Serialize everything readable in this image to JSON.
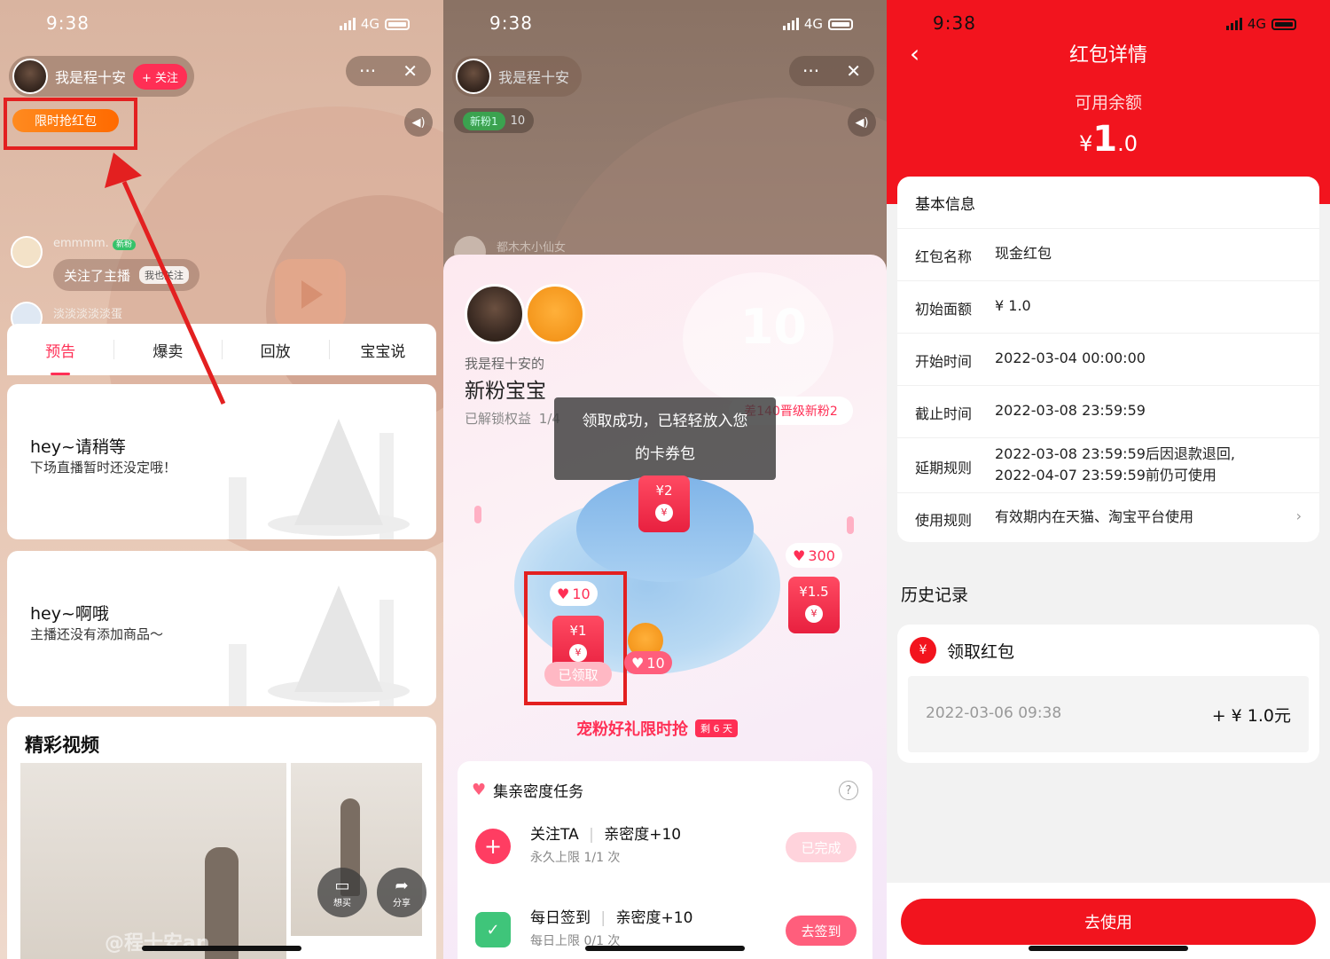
{
  "status": {
    "time": "9:38",
    "network": "4G"
  },
  "panel1": {
    "host_name": "我是程十安",
    "follow_label": "+ 关注",
    "more_label": "···",
    "close_label": "✕",
    "redpacket_tag": "限时抢红包",
    "chat": [
      {
        "user": "emmmm.",
        "badge": "新粉",
        "message": "关注了主播",
        "tag": "我也关注"
      },
      {
        "user": "淡淡淡淡淡蛋"
      }
    ],
    "tabs": [
      "预告",
      "爆卖",
      "回放",
      "宝宝说"
    ],
    "cards": [
      {
        "title": "hey~请稍等",
        "subtitle": "下场直播暂时还没定哦！"
      },
      {
        "title": "hey~啊哦",
        "subtitle": "主播还没有添加商品～"
      }
    ],
    "video_section_title": "精彩视频",
    "watermark": "@程十安an",
    "float_buttons": [
      {
        "icon": "chat-icon",
        "label": "想买"
      },
      {
        "icon": "share-icon",
        "label": "分享"
      }
    ]
  },
  "panel2": {
    "host_name": "我是程十安",
    "fan_badge": "新粉1",
    "fan_count": "10",
    "chat_user": "都木木小仙女",
    "fans_owner": "我是程十安的",
    "fans_title": "新粉宝宝",
    "unlocked_text": "已解锁权益",
    "unlocked_count": "1/4",
    "heart_number": "10",
    "upgrade_text": "差140晋级新粉2",
    "toast_line1": "领取成功，已轻轻放入您",
    "toast_line2": "的卡券包",
    "envelopes": [
      {
        "value": "¥2"
      },
      {
        "value": "¥1",
        "hearts": "10",
        "status": "已领取"
      },
      {
        "value": "¥1.5",
        "hearts": "300"
      }
    ],
    "small_hearts": "10",
    "limit_title": "宠粉好礼限时抢",
    "days_left": "剩 6 天",
    "task_section_title": "集亲密度任务",
    "tasks": [
      {
        "name": "关注TA",
        "reward": "亲密度+10",
        "limit": "永久上限 1/1 次",
        "button": "已完成"
      },
      {
        "name": "每日签到",
        "reward": "亲密度+10",
        "limit": "每日上限 0/1 次",
        "button": "去签到"
      }
    ]
  },
  "panel3": {
    "title": "红包详情",
    "balance_label": "可用余额",
    "balance_currency": "¥",
    "balance_int": "1",
    "balance_dec": ".0",
    "basic_info_title": "基本信息",
    "rows": [
      {
        "key": "红包名称",
        "value": "现金红包"
      },
      {
        "key": "初始面额",
        "value": "¥ 1.0"
      },
      {
        "key": "开始时间",
        "value": "2022-03-04 00:00:00"
      },
      {
        "key": "截止时间",
        "value": "2022-03-08 23:59:59"
      },
      {
        "key": "延期规则",
        "value_line1": "2022-03-08 23:59:59后因退款退回,",
        "value_line2": "2022-04-07 23:59:59前仍可使用"
      },
      {
        "key": "使用规则",
        "value": "有效期内在天猫、淘宝平台使用"
      }
    ],
    "history_title": "历史记录",
    "history_item": {
      "name": "领取红包",
      "time": "2022-03-06 09:38",
      "amount": "+ ¥ 1.0元"
    },
    "use_button": "去使用"
  },
  "colors": {
    "accent": "#ff2f55",
    "taobao_red": "#f2141e",
    "orange": "#ff6a00",
    "highlight": "#e32020"
  }
}
